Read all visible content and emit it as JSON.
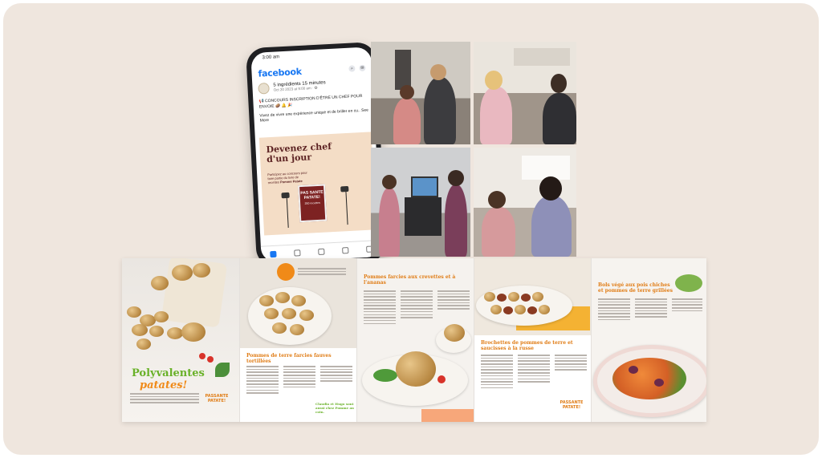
{
  "phone": {
    "status_time": "3:00 am",
    "app_name": "facebook",
    "post_author": "5 ingrédients 15 minutes",
    "post_meta": "Oct 20 2023 at 9:00 am · ✪",
    "post_line1": "📢 CONCOURS INSCRIPTION D'ÊTRE UN CHEF POUR ENVOIE 🥔 🔔 🎉",
    "post_line2": "Vivez de vivre une expérience unique et de briller en cu.. See More",
    "ad_title": "Devenez chef d'un jour",
    "ad_small": "Participez au concours pour faire partie du livre de recettes",
    "ad_small2": "Pomme Patate",
    "book_title": "PAS SANTE PATATE!",
    "book_sub": "250 recettes"
  },
  "magazine": {
    "title_line1": "Polyvalentes",
    "title_line2": "patates!",
    "cover_badge": "PASSANTE PATATE!",
    "p2_title": "Pommes de terre farcies fauves tortillées",
    "p2_tagline": "Claudia et Hugo sont aussi chez Pomme au coin.",
    "p3_title": "Pommes farcies aux crevettes et à l'ananas",
    "p4_title": "Brochettes de pommes de terre et saucisses à la russe",
    "p4_badge": "PASSANTE PATATE!",
    "p5_title": "Bols végé aux pois chiches et pommes de terre grillées"
  },
  "colors": {
    "background": "#efe6de",
    "facebook_blue": "#1877f2",
    "title_green": "#69b128",
    "title_orange": "#f08a18",
    "ad_red": "#5c2222"
  },
  "icons": [
    "search-icon",
    "messenger-icon",
    "home-icon",
    "friends-icon",
    "video-icon",
    "notifications-icon",
    "menu-icon"
  ]
}
